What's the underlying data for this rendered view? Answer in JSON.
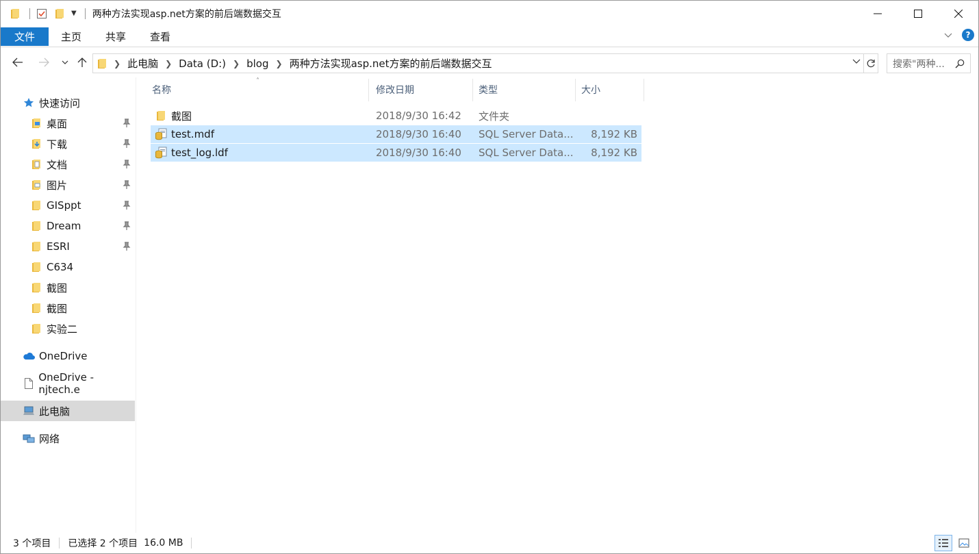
{
  "window": {
    "title": "两种方法实现asp.net方案的前后端数据交互"
  },
  "ribbon": {
    "tabs": [
      "文件",
      "主页",
      "共享",
      "查看"
    ]
  },
  "address": {
    "crumbs": [
      "此电脑",
      "Data (D:)",
      "blog",
      "两种方法实现asp.net方案的前后端数据交互"
    ],
    "search_placeholder": "搜索\"两种...",
    "expand_symbol": "⌄"
  },
  "nav": {
    "quick_access": "快速访问",
    "items": [
      {
        "label": "桌面",
        "pinned": true,
        "icon": "desktop-folder-icon"
      },
      {
        "label": "下载",
        "pinned": true,
        "icon": "download-folder-icon"
      },
      {
        "label": "文档",
        "pinned": true,
        "icon": "documents-folder-icon"
      },
      {
        "label": "图片",
        "pinned": true,
        "icon": "pictures-folder-icon"
      },
      {
        "label": "GISppt",
        "pinned": true,
        "icon": "folder-icon"
      },
      {
        "label": "Dream",
        "pinned": true,
        "icon": "folder-icon"
      },
      {
        "label": "ESRI",
        "pinned": true,
        "icon": "folder-icon"
      },
      {
        "label": "C634",
        "pinned": false,
        "icon": "folder-icon"
      },
      {
        "label": "截图",
        "pinned": false,
        "icon": "folder-icon"
      },
      {
        "label": "截图",
        "pinned": false,
        "icon": "folder-icon"
      },
      {
        "label": "实验二",
        "pinned": false,
        "icon": "folder-icon"
      }
    ],
    "onedrive": "OneDrive",
    "onedrive_biz": "OneDrive - njtech.e",
    "this_pc": "此电脑",
    "network": "网络"
  },
  "columns": {
    "name": "名称",
    "modified": "修改日期",
    "type": "类型",
    "size": "大小"
  },
  "files": [
    {
      "name": "截图",
      "modified": "2018/9/30 16:42",
      "type": "文件夹",
      "size": "",
      "selected": false,
      "icon": "folder-icon"
    },
    {
      "name": "test.mdf",
      "modified": "2018/9/30 16:40",
      "type": "SQL Server Data...",
      "size": "8,192 KB",
      "selected": true,
      "icon": "sql-data-file-icon"
    },
    {
      "name": "test_log.ldf",
      "modified": "2018/9/30 16:40",
      "type": "SQL Server Data...",
      "size": "8,192 KB",
      "selected": true,
      "icon": "sql-data-file-icon"
    }
  ],
  "status": {
    "count": "3 个项目",
    "selection": "已选择 2 个项目",
    "size": "16.0 MB"
  },
  "colors": {
    "accent": "#1979ca",
    "selection": "#cce8ff",
    "folder": "#f8d775"
  }
}
